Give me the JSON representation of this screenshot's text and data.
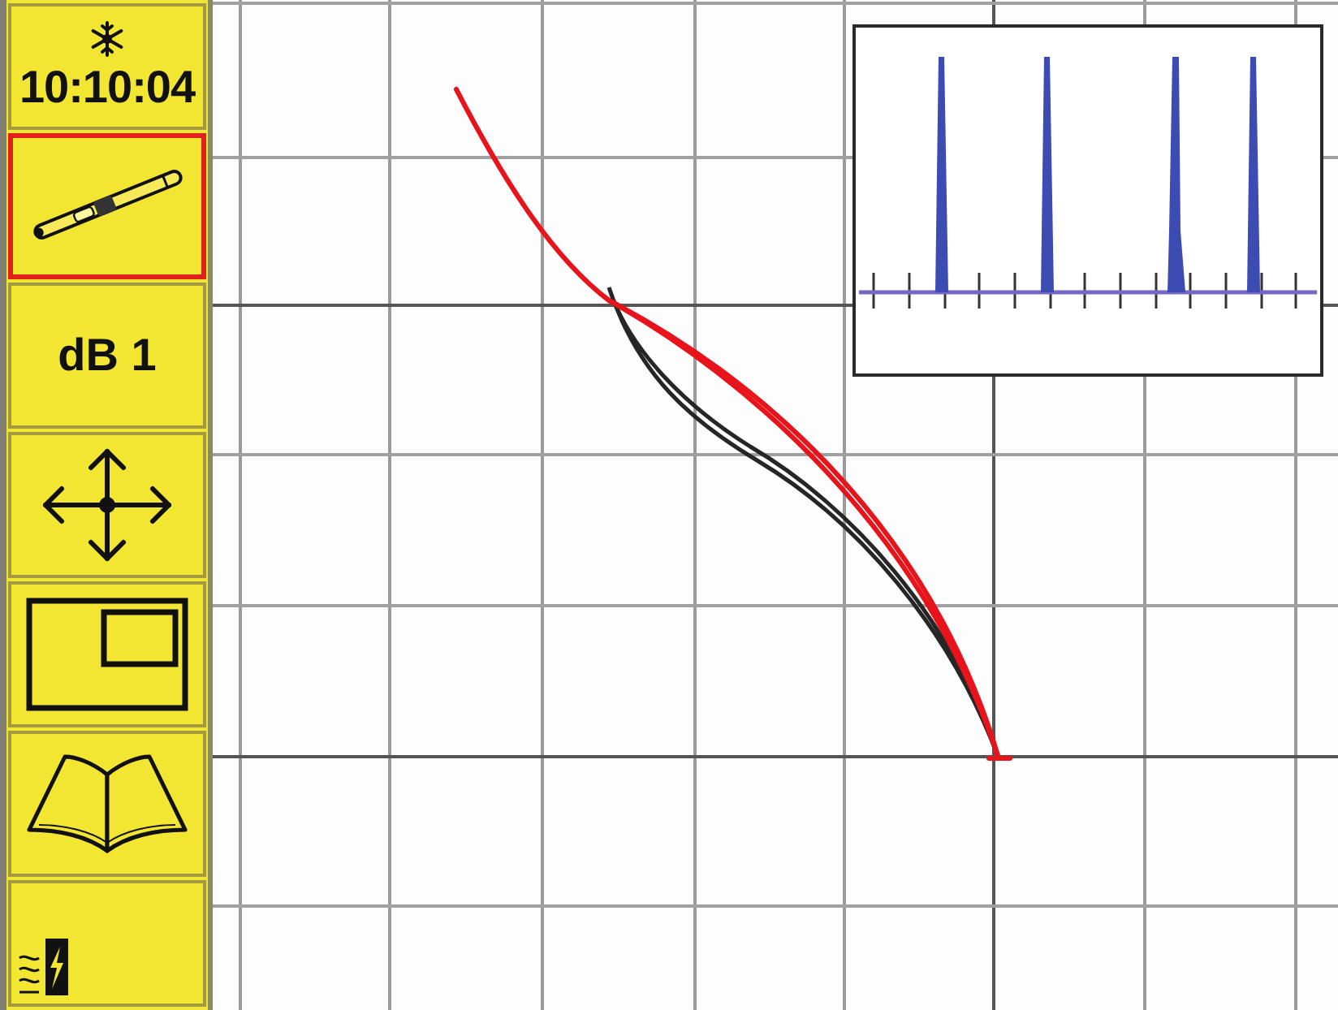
{
  "status": {
    "frozen": true,
    "time": "10:10:04"
  },
  "sidebar": {
    "items": [
      {
        "kind": "probe",
        "selected": true
      },
      {
        "kind": "gain",
        "label": "dB 1",
        "selected": false
      },
      {
        "kind": "pan",
        "selected": false
      },
      {
        "kind": "layout",
        "selected": false
      },
      {
        "kind": "manual",
        "selected": false
      }
    ]
  }
}
